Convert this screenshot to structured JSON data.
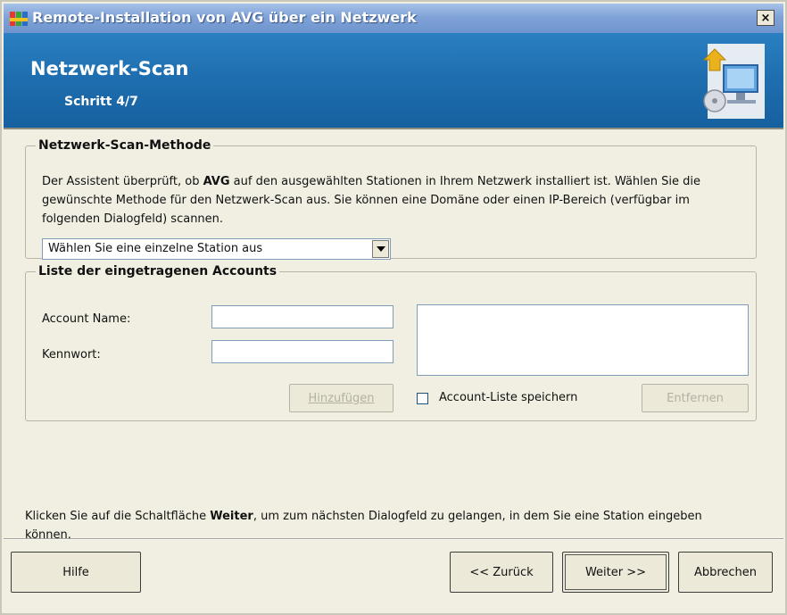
{
  "window": {
    "title": "Remote-Installation von AVG über ein Netzwerk",
    "close_glyph": "×"
  },
  "banner": {
    "title": "Netzwerk-Scan",
    "step": "Schritt 4/7",
    "logo_icon": "network-installation-icon"
  },
  "scan_method": {
    "legend": "Netzwerk-Scan-Methode",
    "desc_part1": "Der Assistent überprüft, ob ",
    "desc_bold": "AVG",
    "desc_part2": " auf den ausgewählten Stationen in Ihrem Netzwerk installiert ist. Wählen Sie die gewünschte Methode für den Netzwerk-Scan aus. Sie können eine Domäne oder einen IP-Bereich (verfügbar im folgenden Dialogfeld) scannen.",
    "combo_value": "Wählen Sie eine einzelne Station aus"
  },
  "accounts": {
    "legend": "Liste der eingetragenen Accounts",
    "account_name_label": "Account Name:",
    "password_label": "Kennwort:",
    "account_name_value": "",
    "password_value": "",
    "add_button": "Hinzufügen",
    "save_checkbox_label": "Account-Liste speichern",
    "save_checked": false,
    "remove_button": "Entfernen"
  },
  "footer": {
    "part1": "Klicken Sie auf die Schaltfläche ",
    "bold": "Weiter",
    "part2": ", um zum nächsten Dialogfeld zu gelangen, in dem Sie eine Station eingeben können."
  },
  "buttons": {
    "help": "Hilfe",
    "back": "<< Zurück",
    "next": "Weiter >>",
    "cancel": "Abbrechen"
  },
  "colors": {
    "banner": "#1f6fb0",
    "titlebar": "#7fa3d8",
    "dialog_bg": "#f1efe2"
  }
}
